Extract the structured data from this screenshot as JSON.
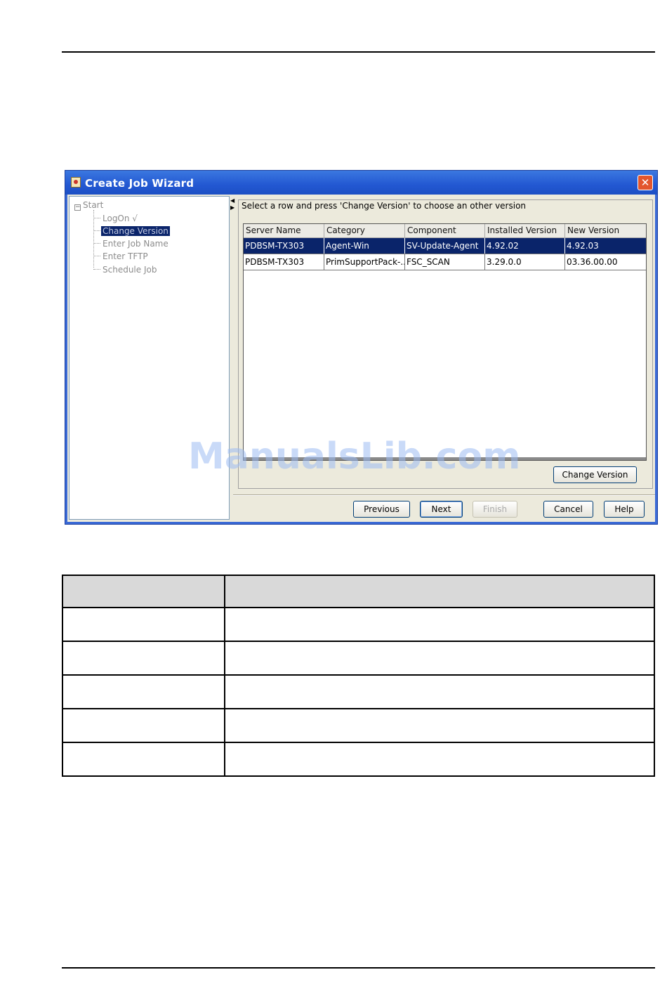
{
  "window": {
    "title": "Create Job Wizard",
    "close_glyph": "✕"
  },
  "tree": {
    "root": "Start",
    "items": [
      {
        "label": "LogOn √",
        "selected": false
      },
      {
        "label": "Change Version",
        "selected": true
      },
      {
        "label": "Enter Job Name",
        "selected": false
      },
      {
        "label": "Enter TFTP",
        "selected": false
      },
      {
        "label": "Schedule Job",
        "selected": false
      }
    ]
  },
  "instruction": "Select a row and press 'Change Version' to choose an other version",
  "table": {
    "columns": [
      "Server Name",
      "Category",
      "Component",
      "Installed Version",
      "New Version"
    ],
    "rows": [
      [
        "PDBSM-TX303",
        "Agent-Win",
        "SV-Update-Agent",
        "4.92.02",
        "4.92.03"
      ],
      [
        "PDBSM-TX303",
        "PrimSupportPack-...",
        "FSC_SCAN",
        "3.29.0.0",
        "03.36.00.00"
      ]
    ],
    "selected_row": 0
  },
  "buttons": {
    "change_version": "Change Version",
    "previous": "Previous",
    "next": "Next",
    "finish": "Finish",
    "cancel": "Cancel",
    "help": "Help"
  },
  "watermark": "ManualsLib.com",
  "colors": {
    "titlebar": "#2358d2",
    "selection": "#0a246a",
    "dialog_bg": "#eceadc"
  }
}
